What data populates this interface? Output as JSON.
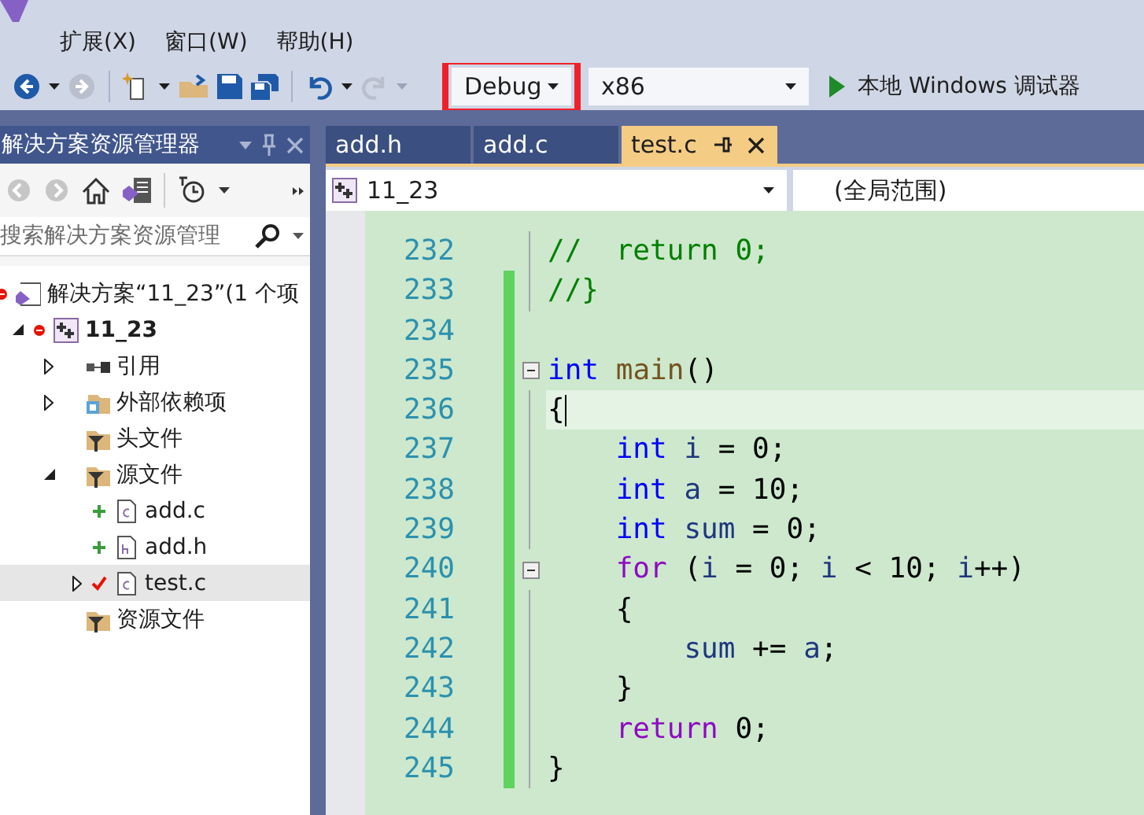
{
  "menu": {
    "items": [
      {
        "label": "扩展(X)"
      },
      {
        "label": "窗口(W)"
      },
      {
        "label": "帮助(H)"
      }
    ]
  },
  "toolbar": {
    "configuration": {
      "value": "Debug",
      "highlighted": true
    },
    "platform": {
      "value": "x86"
    },
    "run_button": {
      "label": "本地 Windows 调试器"
    }
  },
  "solution_explorer": {
    "title": "解决方案资源管理器",
    "search": {
      "placeholder": "搜索解决方案资源管理"
    },
    "tree": [
      {
        "label": "解决方案“11_23”(1 个项",
        "kind": "solution",
        "error": true,
        "added": false,
        "checked": false,
        "selected": false,
        "children": [
          {
            "label": "11_23",
            "kind": "project",
            "error": true,
            "added": false,
            "checked": false,
            "expanded": true,
            "selected": false,
            "children": [
              {
                "label": "引用",
                "kind": "references",
                "error": false,
                "added": false,
                "checked": false,
                "expanded": false,
                "selected": false
              },
              {
                "label": "外部依赖项",
                "kind": "external",
                "error": false,
                "added": false,
                "checked": false,
                "expanded": false,
                "selected": false
              },
              {
                "label": "头文件",
                "kind": "filter",
                "error": false,
                "added": false,
                "checked": false,
                "selected": false
              },
              {
                "label": "源文件",
                "kind": "filter",
                "error": false,
                "added": false,
                "checked": false,
                "expanded": true,
                "selected": false,
                "children": [
                  {
                    "label": "add.c",
                    "kind": "c-file",
                    "error": false,
                    "added": true,
                    "checked": false,
                    "selected": false
                  },
                  {
                    "label": "add.h",
                    "kind": "h-file",
                    "error": false,
                    "added": true,
                    "checked": false,
                    "selected": false
                  },
                  {
                    "label": "test.c",
                    "kind": "c-file",
                    "error": false,
                    "added": false,
                    "checked": true,
                    "expanded": false,
                    "selected": true
                  }
                ]
              },
              {
                "label": "资源文件",
                "kind": "filter",
                "error": false,
                "added": false,
                "checked": false,
                "selected": false
              }
            ]
          }
        ]
      }
    ]
  },
  "editor": {
    "tabs": [
      {
        "label": "add.h",
        "selected": false
      },
      {
        "label": "add.c",
        "selected": false
      },
      {
        "label": "test.c",
        "selected": true
      }
    ],
    "navigation": {
      "project": "11_23",
      "scope": "(全局范围)"
    },
    "lines": [
      {
        "number": "232",
        "changed": false,
        "current": false,
        "fold": false,
        "tokens": [
          {
            "text": "//  return 0;",
            "kind": "comment"
          }
        ]
      },
      {
        "number": "233",
        "changed": true,
        "current": false,
        "fold": false,
        "tokens": [
          {
            "text": "//}",
            "kind": "comment"
          }
        ]
      },
      {
        "number": "234",
        "changed": true,
        "current": false,
        "fold": false
      },
      {
        "number": "235",
        "changed": true,
        "current": false,
        "fold": true,
        "tokens": [
          {
            "text": "int ",
            "kind": "keyword"
          },
          {
            "text": "main",
            "kind": "function"
          },
          {
            "text": "()",
            "kind": "plain"
          }
        ]
      },
      {
        "number": "236",
        "changed": true,
        "current": true,
        "fold": false,
        "tokens": [
          {
            "text": "{",
            "kind": "plain"
          }
        ]
      },
      {
        "number": "237",
        "changed": true,
        "current": false,
        "fold": false,
        "tokens": [
          {
            "text": "    int ",
            "kind": "keyword"
          },
          {
            "text": "i",
            "kind": "local"
          },
          {
            "text": " = 0;",
            "kind": "plain"
          }
        ]
      },
      {
        "number": "238",
        "changed": true,
        "current": false,
        "fold": false,
        "tokens": [
          {
            "text": "    int ",
            "kind": "keyword"
          },
          {
            "text": "a",
            "kind": "local"
          },
          {
            "text": " = 10;",
            "kind": "plain"
          }
        ]
      },
      {
        "number": "239",
        "changed": true,
        "current": false,
        "fold": false,
        "tokens": [
          {
            "text": "    int ",
            "kind": "keyword"
          },
          {
            "text": "sum",
            "kind": "local"
          },
          {
            "text": " = 0;",
            "kind": "plain"
          }
        ]
      },
      {
        "number": "240",
        "changed": true,
        "current": false,
        "fold": true,
        "tokens": [
          {
            "text": "    for",
            "kind": "control"
          },
          {
            "text": " (",
            "kind": "plain"
          },
          {
            "text": "i",
            "kind": "local"
          },
          {
            "text": " = 0; ",
            "kind": "plain"
          },
          {
            "text": "i",
            "kind": "local"
          },
          {
            "text": " < 10; ",
            "kind": "plain"
          },
          {
            "text": "i",
            "kind": "local"
          },
          {
            "text": "++)",
            "kind": "plain"
          }
        ]
      },
      {
        "number": "241",
        "changed": true,
        "current": false,
        "fold": false,
        "tokens": [
          {
            "text": "    {",
            "kind": "plain"
          }
        ]
      },
      {
        "number": "242",
        "changed": true,
        "current": false,
        "fold": false,
        "tokens": [
          {
            "text": "        sum",
            "kind": "local"
          },
          {
            "text": " += ",
            "kind": "plain"
          },
          {
            "text": "a",
            "kind": "local"
          },
          {
            "text": ";",
            "kind": "plain"
          }
        ]
      },
      {
        "number": "243",
        "changed": true,
        "current": false,
        "fold": false,
        "tokens": [
          {
            "text": "    }",
            "kind": "plain"
          }
        ]
      },
      {
        "number": "244",
        "changed": true,
        "current": false,
        "fold": false,
        "tokens": [
          {
            "text": "    return",
            "kind": "control"
          },
          {
            "text": " 0;",
            "kind": "plain"
          }
        ]
      },
      {
        "number": "245",
        "changed": true,
        "current": false,
        "fold": false,
        "tokens": [
          {
            "text": "}",
            "kind": "plain"
          }
        ]
      }
    ]
  }
}
